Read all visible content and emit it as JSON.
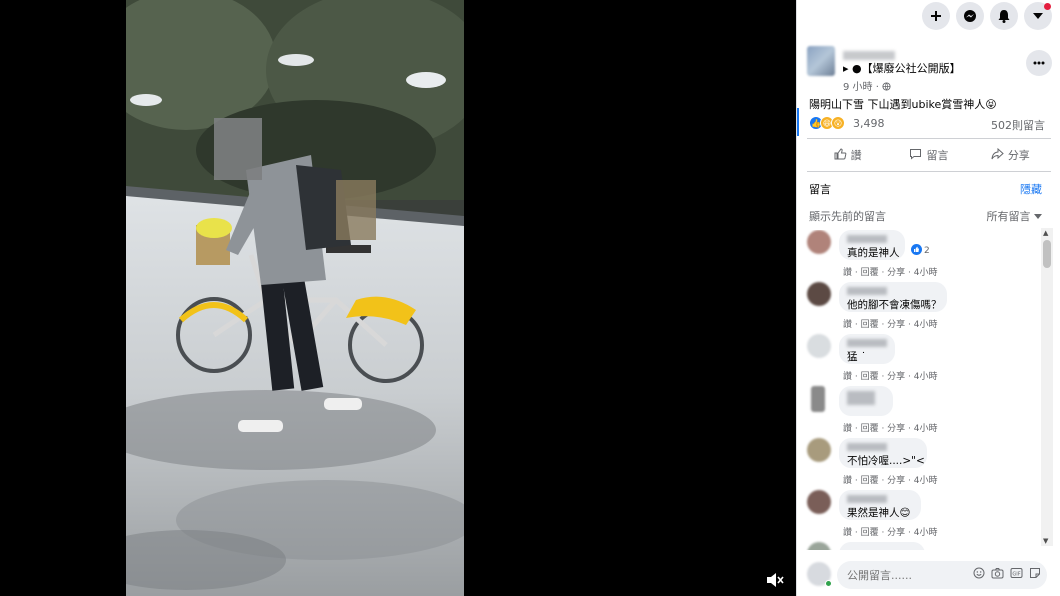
{
  "viewer": {
    "mute_icon": "volume-mute-icon"
  },
  "topbar": {
    "icons": [
      "plus-icon",
      "messenger-icon",
      "bell-icon",
      "caret-down-icon"
    ]
  },
  "post": {
    "page_name": "▸ ●【爆廢公社公開版】",
    "page_name_dot": "●",
    "time": "9 小時 · ",
    "caption": "陽明山下雪 下山遇到ubike賞雪神人😝",
    "reaction_count": "3,498",
    "comment_count": "502則留言"
  },
  "actions": {
    "like": "讚",
    "comment": "留言",
    "share": "分享"
  },
  "comments_section": {
    "title": "留言",
    "hide": "隱藏",
    "previous": "顯示先前的留言",
    "filter": "所有留言"
  },
  "comments": [
    {
      "text": "真的是神人",
      "likes": "2",
      "meta": "讚 · 回覆 · 分享 · 4小時"
    },
    {
      "text": "他的腳不會凍傷嗎？",
      "likes": "",
      "meta": "讚 · 回覆 · 分享 · 4小時"
    },
    {
      "text": "猛 ˙",
      "likes": "",
      "meta": "讚 · 回覆 · 分享 · 4小時"
    },
    {
      "text": "",
      "likes": "",
      "meta": "讚 · 回覆 · 分享 · 4小時"
    },
    {
      "text": "不怕冷喔....>\"<",
      "likes": "",
      "meta": "讚 · 回覆 · 分享 · 4小時"
    },
    {
      "text": "果然是神人😊",
      "likes": "",
      "meta": "讚 · 回覆 · 分享 · 4小時"
    }
  ],
  "composer": {
    "placeholder": "公開留言......"
  }
}
